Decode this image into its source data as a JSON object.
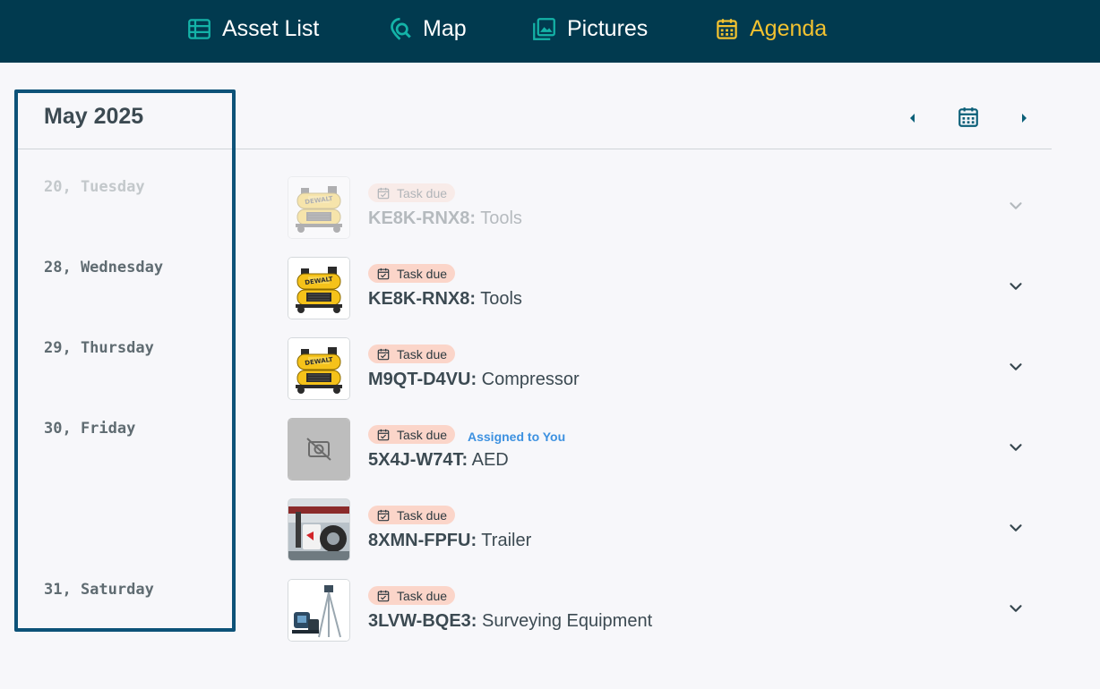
{
  "nav": {
    "items": [
      {
        "label": "Asset List",
        "icon": "list-icon"
      },
      {
        "label": "Map",
        "icon": "map-search-icon"
      },
      {
        "label": "Pictures",
        "icon": "pictures-icon"
      },
      {
        "label": "Agenda",
        "icon": "calendar-icon",
        "active": true
      }
    ]
  },
  "agenda": {
    "month": "May 2025",
    "days": [
      {
        "label": "20, Tuesday"
      },
      {
        "label": "28, Wednesday"
      },
      {
        "label": "29, Thursday"
      },
      {
        "label": "30, Friday"
      },
      {
        "label": "31, Saturday"
      }
    ],
    "tasks": [
      {
        "badge": "Task due",
        "code": "KE8K-RNX8:",
        "name": " Tools",
        "image": "compressor"
      },
      {
        "badge": "Task due",
        "code": "KE8K-RNX8:",
        "name": " Tools",
        "image": "compressor"
      },
      {
        "badge": "Task due",
        "code": "M9QT-D4VU:",
        "name": " Compressor",
        "image": "compressor"
      },
      {
        "badge": "Task due",
        "assigned": "Assigned to You",
        "code": "5X4J-W74T:",
        "name": " AED",
        "image": "no-photo"
      },
      {
        "badge": "Task due",
        "code": "8XMN-FPFU:",
        "name": " Trailer",
        "image": "trailer"
      },
      {
        "badge": "Task due",
        "code": "3LVW-BQE3:",
        "name": " Surveying Equipment",
        "image": "surveying"
      }
    ]
  },
  "colors": {
    "topbar": "#013a4f",
    "active": "#f2c230",
    "badge": "#fbd5c9",
    "assigned": "#3d91e0",
    "highlight": "#0d5278"
  }
}
